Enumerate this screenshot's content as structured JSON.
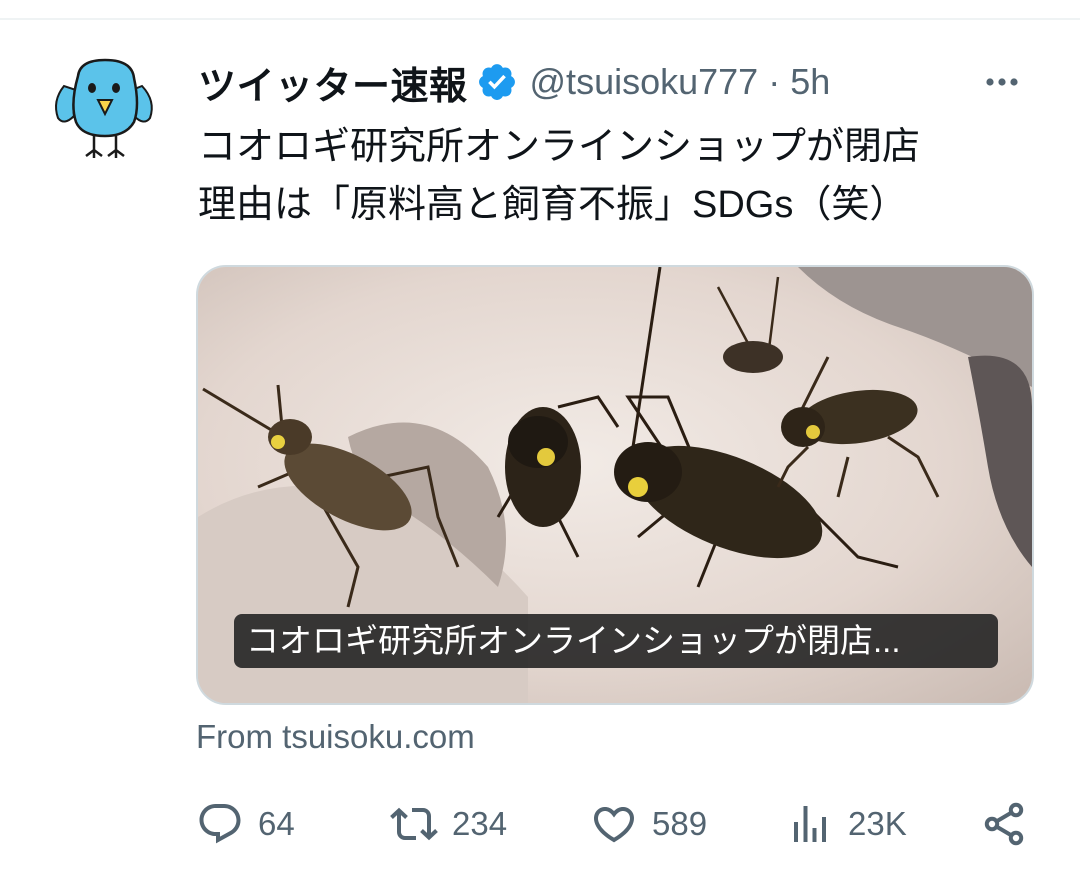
{
  "tweet": {
    "display_name": "ツイッター速報",
    "verified_icon": "verified-badge-icon",
    "handle": "@tsuisoku777",
    "separator": "·",
    "time": "5h",
    "text_line1": "コオロギ研究所オンラインショップが閉店",
    "text_line2": "理由は「原料高と飼育不振」SDGs（笑）",
    "media_caption": "コオロギ研究所オンラインショップが閉店...",
    "source": "From tsuisoku.com"
  },
  "actions": {
    "reply_count": "64",
    "retweet_count": "234",
    "like_count": "589",
    "views_count": "23K"
  },
  "colors": {
    "verified_blue": "#1d9bf0",
    "secondary_text": "#536471",
    "primary_text": "#0f1419"
  }
}
